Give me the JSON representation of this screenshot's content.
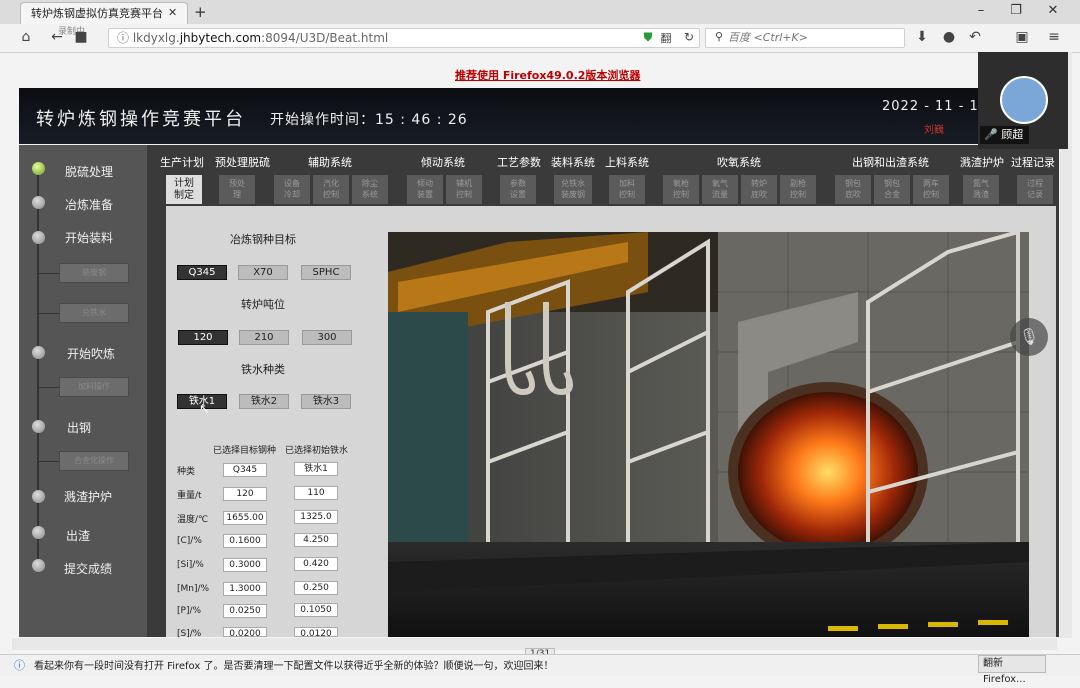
{
  "browser": {
    "tab_title": "转炉炼钢虚拟仿真竞赛平台",
    "tab_close": "✕",
    "new_tab": "+",
    "win_minimize": "–",
    "win_restore": "❐",
    "win_close": "✕",
    "url_prefix": "lkdyxlg.",
    "url_domain": "jhbytech.com",
    "url_suffix": ":8094/U3D/Beat.html",
    "search_placeholder": "百度 <Ctrl+K>",
    "recording": "录制中"
  },
  "notice": "推荐使用 Firefox49.0.2版本浏览器",
  "app": {
    "title": "转炉炼钢操作竞赛平台",
    "start_time_label": "开始操作时间：15 : 46 : 26",
    "date": "2022 - 11 - 13",
    "user_tag": "刘巍"
  },
  "sidebar": {
    "steps": [
      {
        "label": "脱硫处理",
        "active": true
      },
      {
        "label": "冶炼准备",
        "active": false
      },
      {
        "label": "开始装料",
        "active": false
      },
      {
        "label": "开始吹炼",
        "active": false
      },
      {
        "label": "出钢",
        "active": false
      },
      {
        "label": "溅渣护炉",
        "active": false
      },
      {
        "label": "出渣",
        "active": false
      },
      {
        "label": "提交成绩",
        "active": false
      }
    ],
    "subitems": [
      "装废钢",
      "兑铁水",
      "加料操作",
      "合金化操作"
    ]
  },
  "categories": [
    "生产计划",
    "预处理脱硫",
    "辅助系统",
    "倾动系统",
    "工艺参数",
    "装料系统",
    "上料系统",
    "吹氧系统",
    "出钢和出渣系统",
    "溅渣护炉",
    "过程记录"
  ],
  "subtabs": [
    "计划\n制定",
    "预处\n理",
    "设备\n冷却",
    "汽化\n控制",
    "除尘\n系统",
    "倾动\n装置",
    "辅机\n控制",
    "参数\n设置",
    "兑铁水\n装废钢",
    "加料\n控制",
    "氧枪\n控制",
    "氧气\n流量",
    "转炉\n底吹",
    "副枪\n控制",
    "钢包\n底吹",
    "钢包\n合金",
    "两车\n控制",
    "氮气\n溅渣",
    "过程\n记录"
  ],
  "plan": {
    "grade_label": "冶炼钢种目标",
    "grades": [
      "Q345",
      "X70",
      "SPHC"
    ],
    "grade_selected": 0,
    "tonnage_label": "转炉吨位",
    "tonnages": [
      "120",
      "210",
      "300"
    ],
    "tonnage_selected": 0,
    "iron_label": "铁水种类",
    "irons": [
      "铁水1",
      "铁水2",
      "铁水3"
    ],
    "iron_selected": 0,
    "col_target": "已选择目标钢种",
    "col_iron": "已选择初始铁水",
    "rows": [
      {
        "label": "种类",
        "target": "Q345",
        "iron": "铁水1"
      },
      {
        "label": "重量/t",
        "target": "120",
        "iron": "110"
      },
      {
        "label": "温度/℃",
        "target": "1655.00",
        "iron": "1325.0"
      },
      {
        "label": "[C]/%",
        "target": "0.1600",
        "iron": "4.250"
      },
      {
        "label": "[Si]/%",
        "target": "0.3000",
        "iron": "0.420"
      },
      {
        "label": "[Mn]/%",
        "target": "1.3000",
        "iron": "0.250"
      },
      {
        "label": "[P]/%",
        "target": "0.0250",
        "iron": "0.1050"
      },
      {
        "label": "[S]/%",
        "target": "0.0200",
        "iron": "0.0120"
      }
    ]
  },
  "page_counter": "1/31",
  "status_message": "看起来你有一段时间没有打开 Firefox 了。是否要清理一下配置文件以获得近乎全新的体验？顺便说一句，欢迎回来！",
  "refresh_firefox": "翻新 Firefox...",
  "meeting": {
    "name": "顾超"
  },
  "colors": {
    "accent_active": "#8bc34a",
    "selected_button": "#333333",
    "header_bg": "#0f1218"
  }
}
